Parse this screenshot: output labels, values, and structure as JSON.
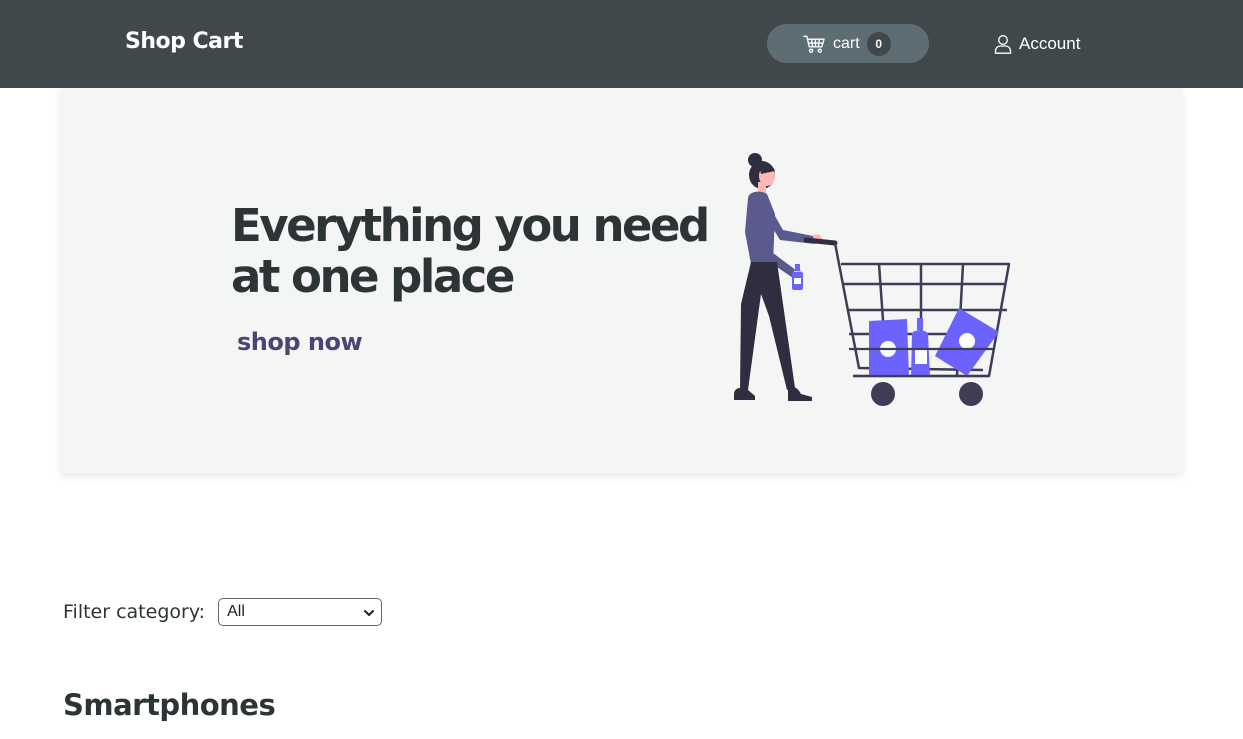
{
  "header": {
    "brand": "Shop Cart",
    "cart": {
      "label": "cart",
      "count": "0",
      "icon": "cart-icon"
    },
    "account": {
      "label": "Account",
      "icon": "user-icon"
    }
  },
  "hero": {
    "title_line1": "Everything you need",
    "title_line2": "at one place",
    "cta": "shop now",
    "illustration": "woman-pushing-shopping-cart-illustration"
  },
  "filter": {
    "label": "Filter category:",
    "selected": "All"
  },
  "section": {
    "heading": "Smartphones"
  },
  "colors": {
    "header_bg": "#41484c",
    "cart_pill": "#5e6d74",
    "hero_bg": "#f4f5f5",
    "accent_purple": "#6c63ff",
    "cta_text": "#4a4574",
    "text_dark": "#2d3436"
  }
}
